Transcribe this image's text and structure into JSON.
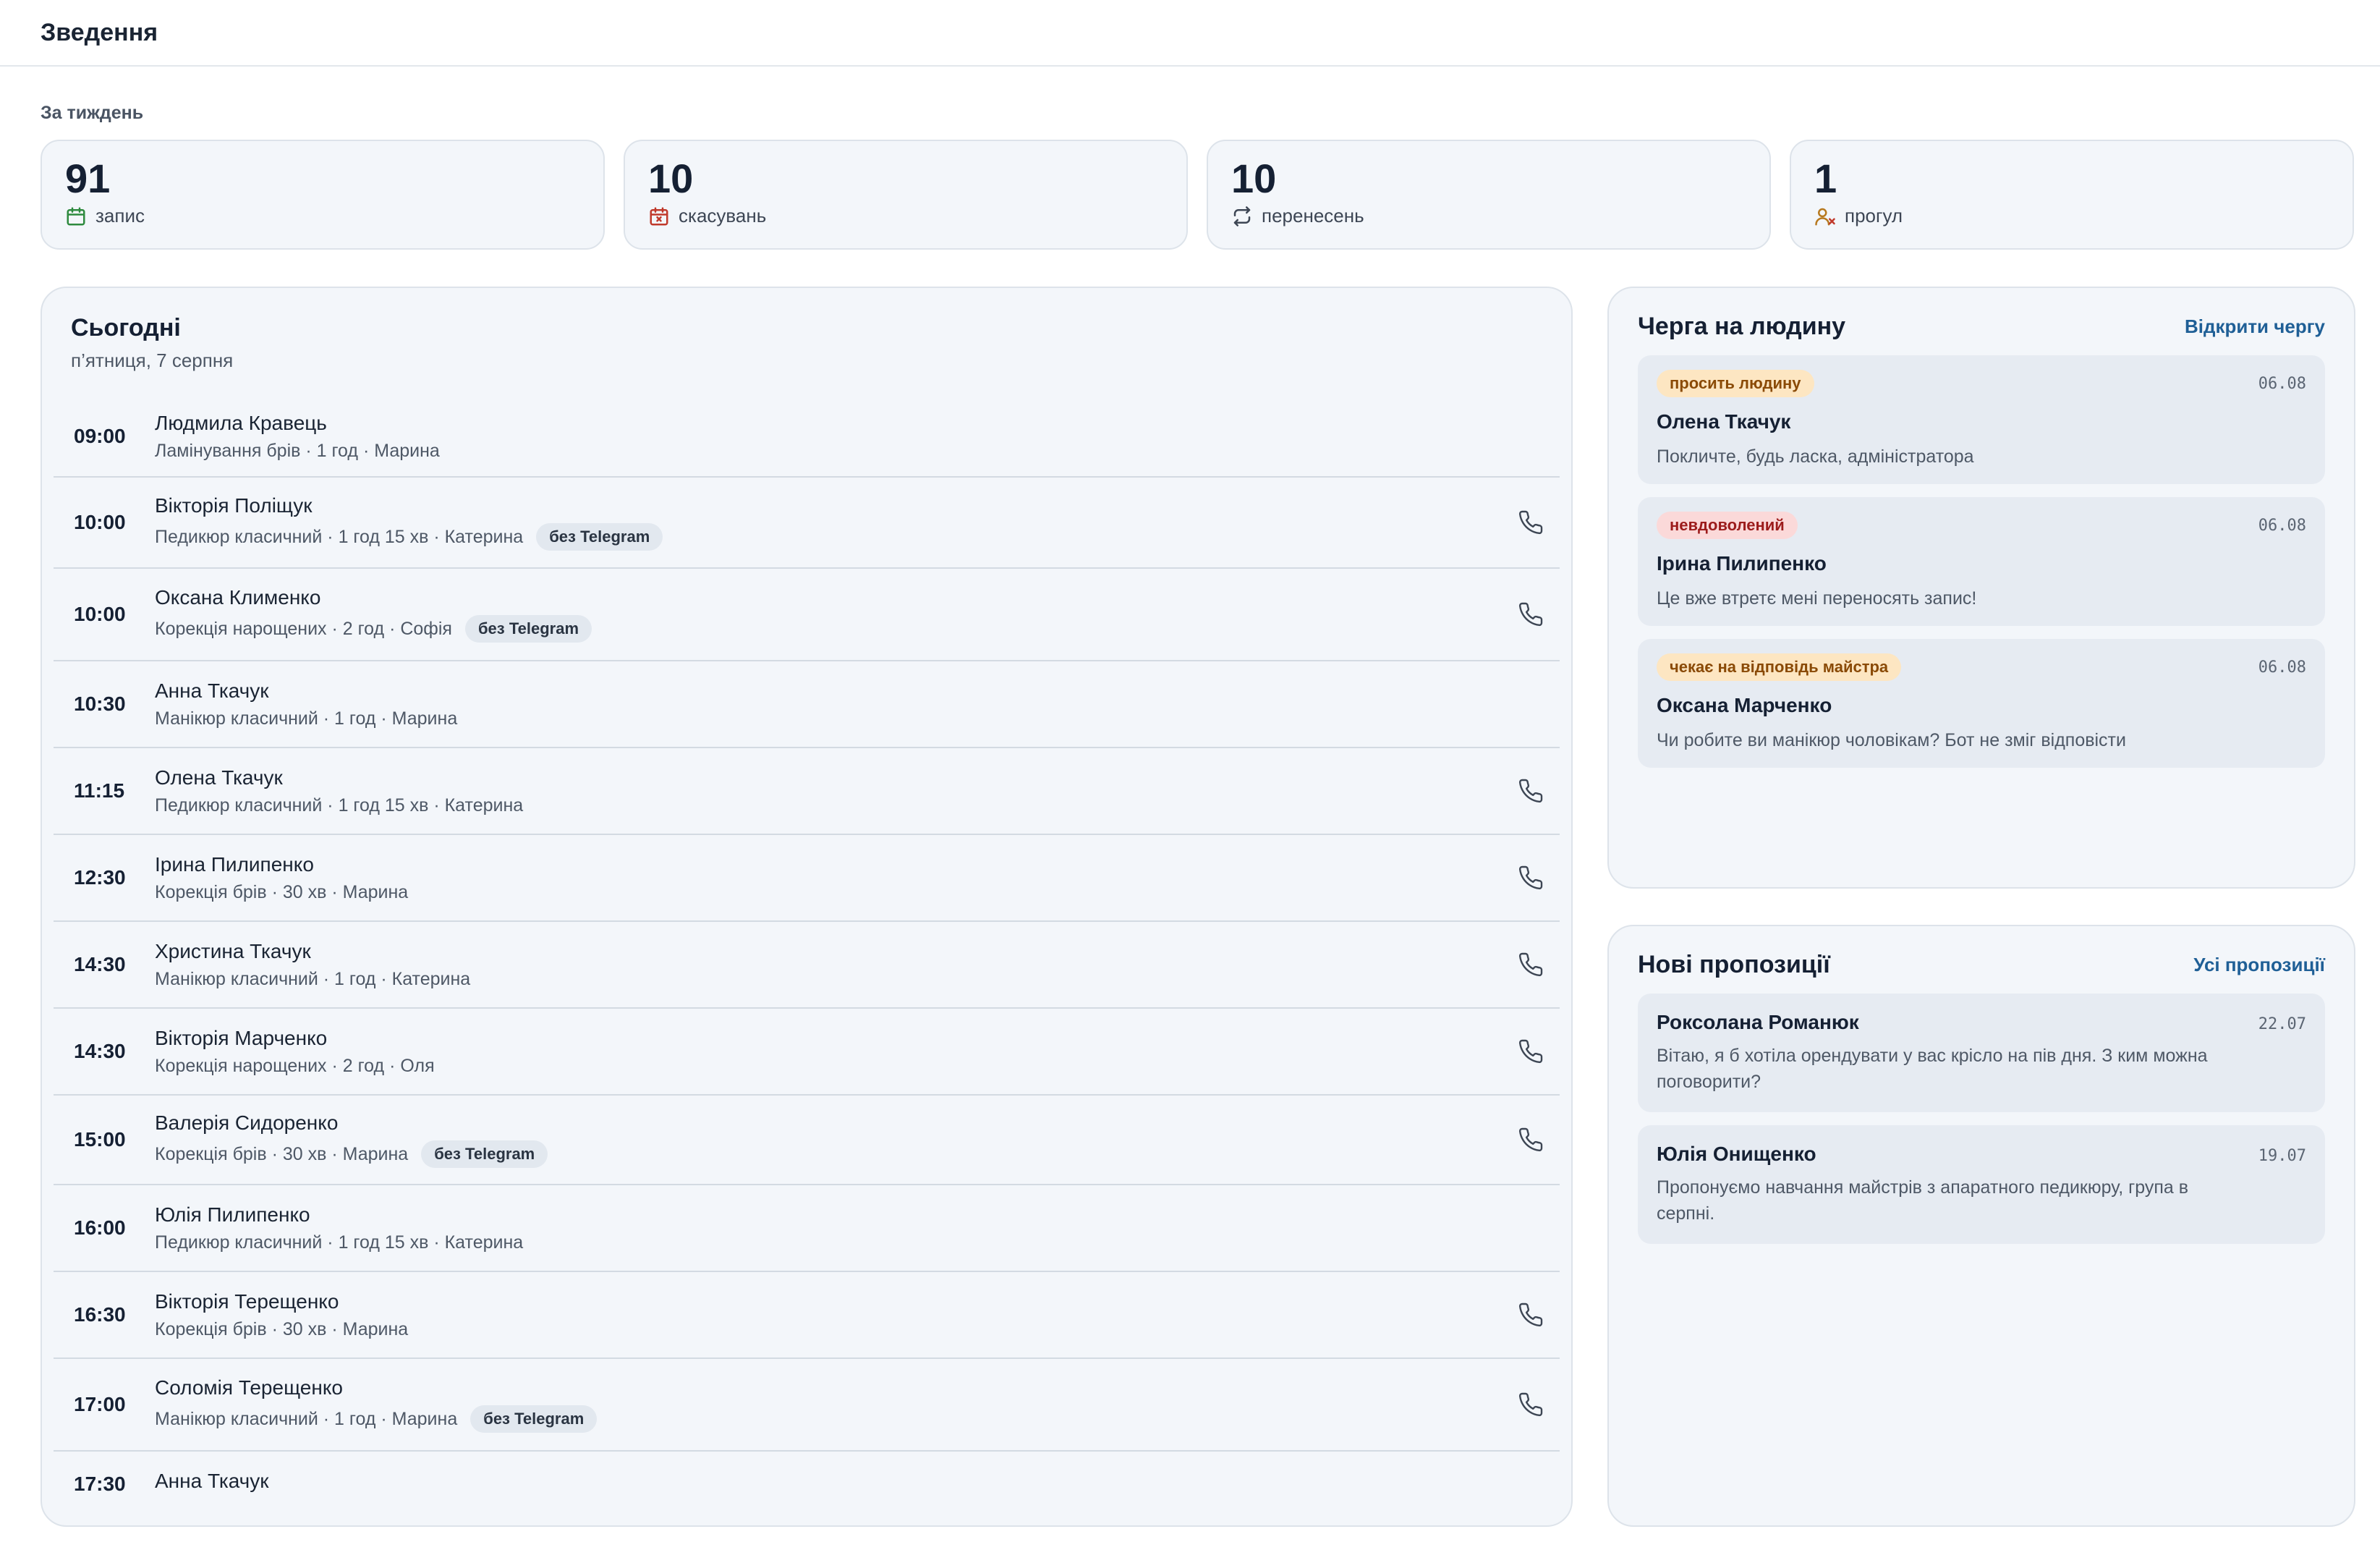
{
  "header": {
    "title": "Зведення"
  },
  "week": {
    "label": "За тиждень",
    "stats": [
      {
        "value": "91",
        "label": "запис",
        "icon": "calendar-icon",
        "color": "#2e8a3e"
      },
      {
        "value": "10",
        "label": "скасувань",
        "icon": "calendar-x-icon",
        "color": "#c0392b"
      },
      {
        "value": "10",
        "label": "перенесень",
        "icon": "repeat-icon",
        "color": "#3d4654"
      },
      {
        "value": "1",
        "label": "прогул",
        "icon": "user-x-icon",
        "color": "#b7791f"
      }
    ]
  },
  "today": {
    "title": "Сьогодні",
    "date": "п’ятниця, 7 серпня",
    "appointments": [
      {
        "time": "09:00",
        "name": "Людмила Кравець",
        "meta": "Ламінування брів · 1 год · Марина",
        "badge": "",
        "phone": false
      },
      {
        "time": "10:00",
        "name": "Вікторія Поліщук",
        "meta": "Педикюр класичний · 1 год 15 хв · Катерина",
        "badge": "без Telegram",
        "phone": true
      },
      {
        "time": "10:00",
        "name": "Оксана Клименко",
        "meta": "Корекція нарощених · 2 год · Софія",
        "badge": "без Telegram",
        "phone": true
      },
      {
        "time": "10:30",
        "name": "Анна Ткачук",
        "meta": "Манікюр класичний · 1 год · Марина",
        "badge": "",
        "phone": false
      },
      {
        "time": "11:15",
        "name": "Олена Ткачук",
        "meta": "Педикюр класичний · 1 год 15 хв · Катерина",
        "badge": "",
        "phone": true
      },
      {
        "time": "12:30",
        "name": "Ірина Пилипенко",
        "meta": "Корекція брів · 30 хв · Марина",
        "badge": "",
        "phone": true
      },
      {
        "time": "14:30",
        "name": "Христина Ткачук",
        "meta": "Манікюр класичний · 1 год · Катерина",
        "badge": "",
        "phone": true
      },
      {
        "time": "14:30",
        "name": "Вікторія Марченко",
        "meta": "Корекція нарощених · 2 год · Оля",
        "badge": "",
        "phone": true
      },
      {
        "time": "15:00",
        "name": "Валерія Сидоренко",
        "meta": "Корекція брів · 30 хв · Марина",
        "badge": "без Telegram",
        "phone": true
      },
      {
        "time": "16:00",
        "name": "Юлія Пилипенко",
        "meta": "Педикюр класичний · 1 год 15 хв · Катерина",
        "badge": "",
        "phone": false
      },
      {
        "time": "16:30",
        "name": "Вікторія Терещенко",
        "meta": "Корекція брів · 30 хв · Марина",
        "badge": "",
        "phone": true
      },
      {
        "time": "17:00",
        "name": "Соломія Терещенко",
        "meta": "Манікюр класичний · 1 год · Марина",
        "badge": "без Telegram",
        "phone": true
      },
      {
        "time": "17:30",
        "name": "Анна Ткачук",
        "meta": "",
        "badge": "",
        "phone": false
      }
    ]
  },
  "queue": {
    "title": "Черга на людину",
    "link": "Відкрити чергу",
    "items": [
      {
        "tag": "просить людину",
        "tag_style": "orange",
        "date": "06.08",
        "name": "Олена Ткачук",
        "text": "Покличте, будь ласка, адміністратора"
      },
      {
        "tag": "невдоволений",
        "tag_style": "red",
        "date": "06.08",
        "name": "Ірина Пилипенко",
        "text": "Це вже втретє мені переносять запис!"
      },
      {
        "tag": "чекає на відповідь майстра",
        "tag_style": "orange",
        "date": "06.08",
        "name": "Оксана Марченко",
        "text": "Чи робите ви манікюр чоловікам? Бот не зміг відповісти"
      }
    ]
  },
  "offers": {
    "title": "Нові пропозиції",
    "link": "Усі пропозиції",
    "items": [
      {
        "name": "Роксолана Романюк",
        "date": "22.07",
        "text": "Вітаю, я б хотіла орендувати у вас крісло на пів дня. З ким можна поговорити?"
      },
      {
        "name": "Юлія Онищенко",
        "date": "19.07",
        "text": "Пропонуємо навчання майстрів з апаратного педикюру, група в серпні."
      }
    ]
  }
}
